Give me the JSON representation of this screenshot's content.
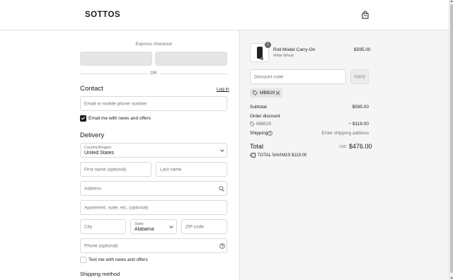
{
  "header": {
    "logo": "SOTTOS",
    "cart_icon": "shopping-bag-icon"
  },
  "express": {
    "title": "Express checkout",
    "or": "OR"
  },
  "contact": {
    "title": "Contact",
    "login_link": "Log in",
    "email_placeholder": "Email or mobile phone number",
    "news_label": "Email me with news and offers",
    "news_checked": true
  },
  "delivery": {
    "title": "Delivery",
    "country_label": "Country/Region",
    "country_value": "United States",
    "first_name_placeholder": "First name (optional)",
    "last_name_placeholder": "Last name",
    "address_placeholder": "Address",
    "apartment_placeholder": "Apartment, suite, etc. (optional)",
    "city_placeholder": "City",
    "state_label": "State",
    "state_value": "Alabama",
    "zip_placeholder": "ZIP code",
    "phone_placeholder": "Phone (optional)",
    "sms_label": "Text me with news and offers",
    "sms_checked": false
  },
  "shipping_method": {
    "title": "Shipping method"
  },
  "summary": {
    "product": {
      "name": "Roll Model Carry-On",
      "variant": "White Wheat",
      "price": "$595.00",
      "quantity": "1"
    },
    "discount_placeholder": "Discount code",
    "apply_label": "Apply",
    "applied_code": "MBB20",
    "subtotal_label": "Subtotal",
    "subtotal_value": "$595.00",
    "order_discount_label": "Order discount",
    "discount_code": "MBB20",
    "discount_value": "− $119.00",
    "shipping_label": "Shipping",
    "shipping_value": "Enter shipping address",
    "total_label": "Total",
    "total_currency": "USD",
    "total_value": "$476.00",
    "savings_label": "TOTAL SAVINGS",
    "savings_value": "$119.00"
  },
  "colors": {
    "panel": "#f5f5f5",
    "border": "#dedede",
    "text": "#1a1a1a",
    "muted": "#707070"
  }
}
